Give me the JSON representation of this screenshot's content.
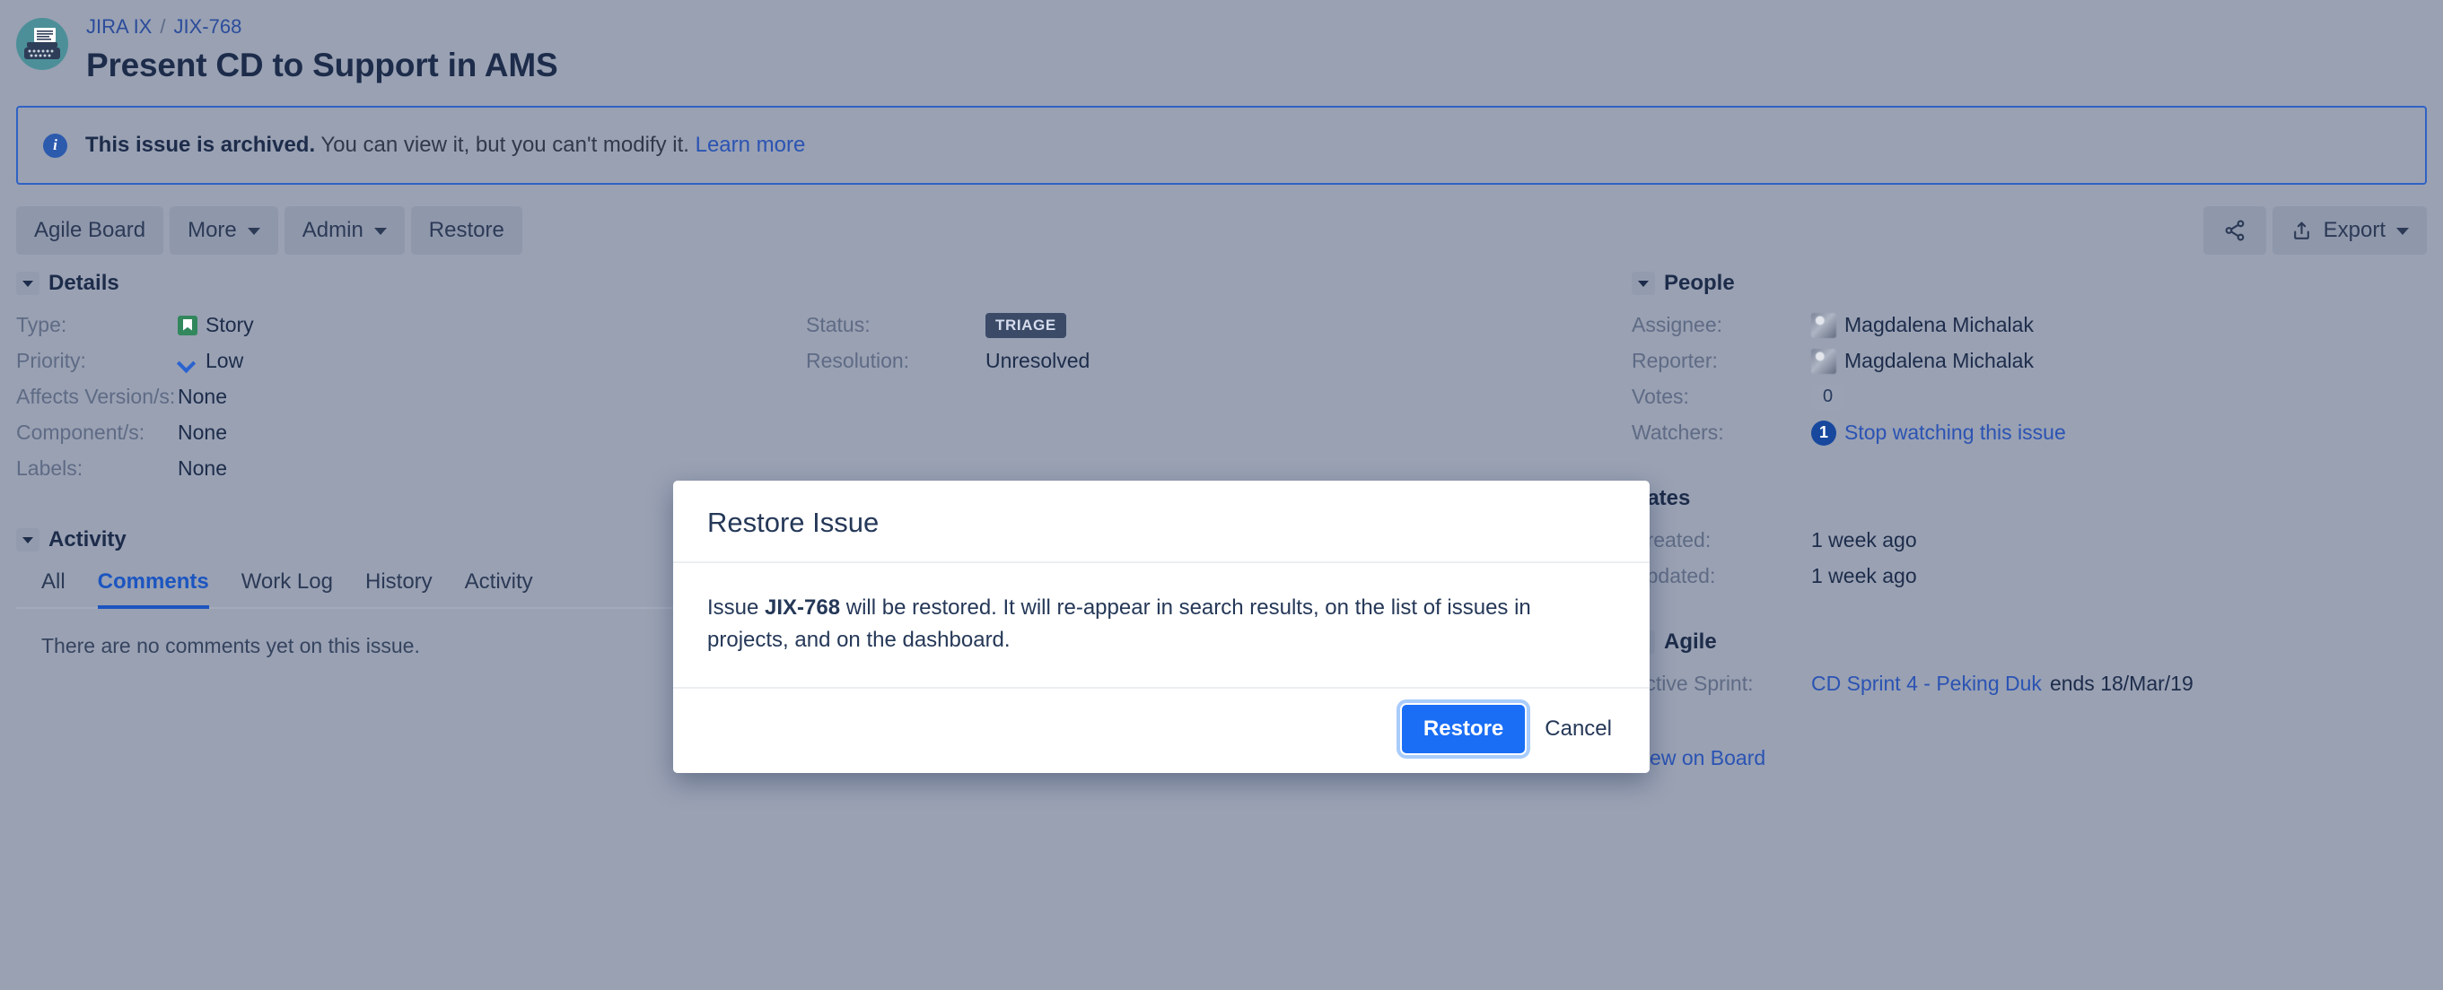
{
  "header": {
    "avatar_icon": "typewriter-icon",
    "breadcrumb": {
      "project": "JIRA IX",
      "separator": "/",
      "issue_key": "JIX-768"
    },
    "issue_title": "Present CD to Support in AMS"
  },
  "banner": {
    "icon": "info-icon",
    "bold_text": "This issue is archived.",
    "text": " You can view it, but you can't modify it. ",
    "link": "Learn more",
    "border_color": "#2f62c4"
  },
  "toolbar": {
    "left": [
      {
        "label": "Agile Board",
        "caret": false
      },
      {
        "label": "More",
        "caret": true
      },
      {
        "label": "Admin",
        "caret": true
      },
      {
        "label": "Restore",
        "caret": false
      }
    ],
    "share_icon": "share-icon",
    "export": {
      "icon": "export-upload-icon",
      "label": "Export",
      "caret": true
    }
  },
  "details": {
    "section_title": "Details",
    "left_fields": [
      {
        "label": "Type:",
        "value": "Story",
        "icon": "story-bookmark-icon"
      },
      {
        "label": "Priority:",
        "value": "Low",
        "icon": "priority-low-chevron-icon"
      },
      {
        "label": "Affects Version/s:",
        "value": "None",
        "icon": ""
      },
      {
        "label": "Component/s:",
        "value": "None",
        "icon": ""
      },
      {
        "label": "Labels:",
        "value": "None",
        "icon": ""
      }
    ],
    "right_fields": [
      {
        "label": "Status:",
        "value": "TRIAGE",
        "kind": "lozenge"
      },
      {
        "label": "Resolution:",
        "value": "Unresolved",
        "kind": "text"
      }
    ]
  },
  "activity": {
    "section_title": "Activity",
    "tabs": [
      {
        "label": "All",
        "active": false
      },
      {
        "label": "Comments",
        "active": true
      },
      {
        "label": "Work Log",
        "active": false
      },
      {
        "label": "History",
        "active": false
      },
      {
        "label": "Activity",
        "active": false
      }
    ],
    "empty_text": "There are no comments yet on this issue."
  },
  "people": {
    "section_title": "People",
    "assignee_label": "Assignee:",
    "assignee_name": "Magdalena Michalak",
    "reporter_label": "Reporter:",
    "reporter_name": "Magdalena Michalak",
    "votes_label": "Votes:",
    "votes_count": "0",
    "watchers_label": "Watchers:",
    "watchers_count": "1",
    "watchers_link": "Stop watching this issue"
  },
  "dates": {
    "section_title": "Dates",
    "created_label": "Created:",
    "created_value": "1 week ago",
    "updated_label": "Updated:",
    "updated_value": "1 week ago"
  },
  "agile": {
    "section_title": "Agile",
    "active_sprint_label": "Active Sprint:",
    "sprint_link": "CD Sprint 4 - Peking Duk",
    "sprint_suffix": " ends 18/Mar/19",
    "view_on_board": "View on Board"
  },
  "modal": {
    "title": "Restore Issue",
    "body_prefix": "Issue ",
    "body_key": "JIX-768",
    "body_suffix": " will be restored. It will re-appear in search results, on the list of issues in projects, and on the dashboard.",
    "confirm_label": "Restore",
    "cancel_label": "Cancel",
    "confirm_color": "#1a6ef5",
    "focus_ring_color": "#a8ccfb"
  }
}
